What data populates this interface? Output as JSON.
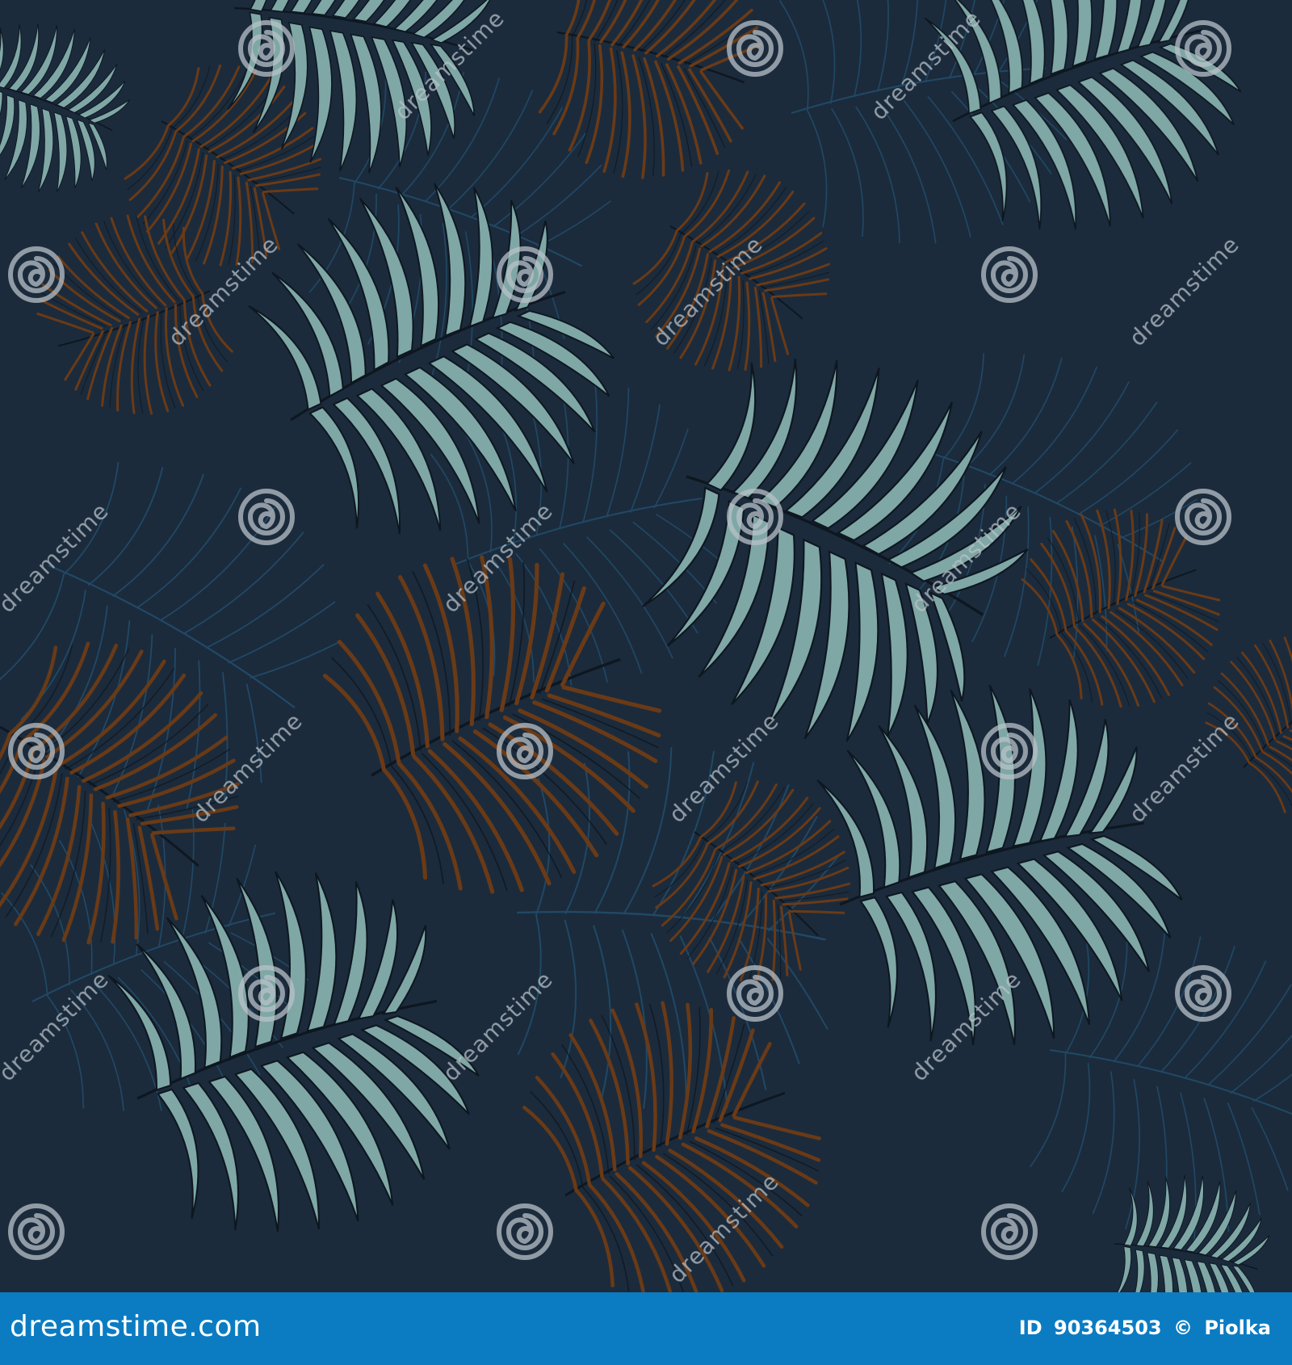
{
  "artwork": {
    "subject": "seamless palm leaf pattern",
    "palette": {
      "background": "#1b2b3c",
      "light_leaf": "#7fa7a6",
      "brown_leaf": "#6a3a16",
      "faint_leaf": "#23506e",
      "outline": "#0e1720"
    },
    "watermark": {
      "text": "dreamstime",
      "icon": "spiral-logo-icon"
    }
  },
  "footer": {
    "site": "dreamstime.com",
    "id_label": "ID",
    "id_value": "90364503",
    "copyright_symbol": "©",
    "author": "Piolka",
    "background": "#0b7cc2",
    "text_color": "#ffffff"
  }
}
